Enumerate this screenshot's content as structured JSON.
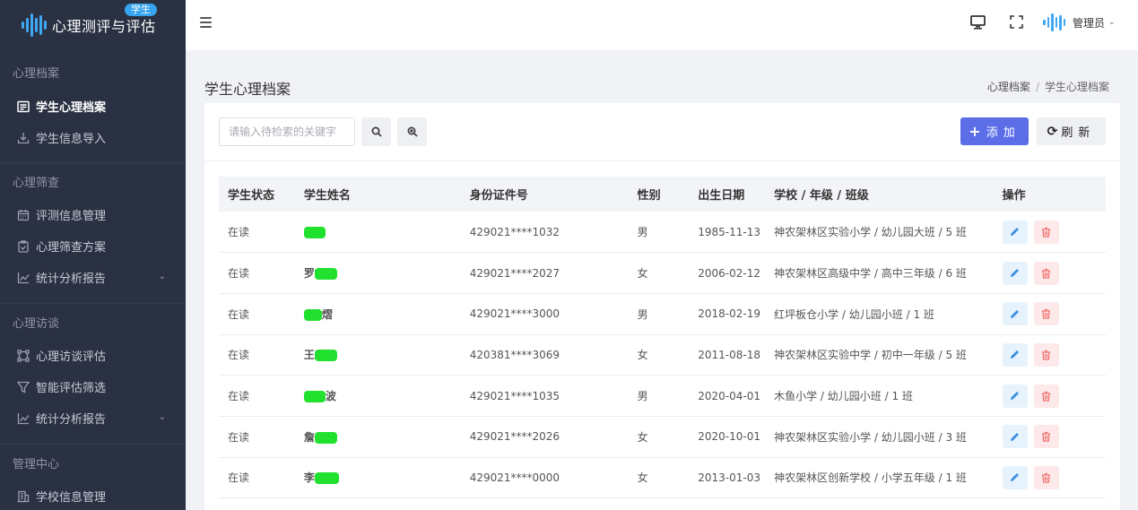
{
  "app": {
    "title": "心理测评与评估",
    "badge": "学生"
  },
  "sidebar": {
    "sections": [
      {
        "title": "心理档案",
        "items": [
          {
            "label": "学生心理档案",
            "icon": "list-doc-icon",
            "active": true
          },
          {
            "label": "学生信息导入",
            "icon": "import-icon"
          }
        ]
      },
      {
        "title": "心理筛查",
        "items": [
          {
            "label": "评测信息管理",
            "icon": "calendar-icon"
          },
          {
            "label": "心理筛查方案",
            "icon": "clipboard-icon"
          },
          {
            "label": "统计分析报告",
            "icon": "line-chart-icon",
            "expandable": true
          }
        ]
      },
      {
        "title": "心理访谈",
        "items": [
          {
            "label": "心理访谈评估",
            "icon": "nodes-icon"
          },
          {
            "label": "智能评估筛选",
            "icon": "filter-icon"
          },
          {
            "label": "统计分析报告",
            "icon": "line-chart-icon",
            "expandable": true
          }
        ]
      },
      {
        "title": "管理中心",
        "items": [
          {
            "label": "学校信息管理",
            "icon": "building-icon"
          }
        ]
      }
    ]
  },
  "header": {
    "user": "管理员"
  },
  "page": {
    "title": "学生心理档案",
    "breadcrumb": [
      "心理档案",
      "学生心理档案"
    ]
  },
  "toolbar": {
    "search_placeholder": "请输入待检索的关键字",
    "add_label": "添加",
    "refresh_label": "刷新"
  },
  "table": {
    "columns": [
      "学生状态",
      "学生姓名",
      "身份证件号",
      "性别",
      "出生日期",
      "学校 / 年级 / 班级",
      "操作"
    ],
    "rows": [
      {
        "status": "在读",
        "name": "",
        "id": "429021****1032",
        "gender": "男",
        "birth": "1985-11-13",
        "school": "神农架林区实验小学 / 幼儿园大班 / 5 班"
      },
      {
        "status": "在读",
        "name": "罗",
        "id": "429021****2027",
        "gender": "女",
        "birth": "2006-02-12",
        "school": "神农架林区高级中学 / 高中三年级 / 6 班"
      },
      {
        "status": "在读",
        "name": "熠",
        "id": "429021****3000",
        "gender": "男",
        "birth": "2018-02-19",
        "school": "红坪板仓小学 / 幼儿园小班 / 1 班"
      },
      {
        "status": "在读",
        "name": "王",
        "id": "420381****3069",
        "gender": "女",
        "birth": "2011-08-18",
        "school": "神农架林区实验中学 / 初中一年级 / 5 班"
      },
      {
        "status": "在读",
        "name": "波",
        "id": "429021****1035",
        "gender": "男",
        "birth": "2020-04-01",
        "school": "木鱼小学 / 幼儿园小班 / 1 班"
      },
      {
        "status": "在读",
        "name": "詹",
        "id": "429021****2026",
        "gender": "女",
        "birth": "2020-10-01",
        "school": "神农架林区实验小学 / 幼儿园小班 / 3 班"
      },
      {
        "status": "在读",
        "name": "李",
        "id": "429021****0000",
        "gender": "女",
        "birth": "2013-01-03",
        "school": "神农架林区创新学校 / 小学五年级 / 1 班"
      }
    ]
  },
  "colors": {
    "sidebar": "#2a3142",
    "accent": "#5b6ee8",
    "brand": "#3ea8f5",
    "redaction": "#22e02e"
  }
}
